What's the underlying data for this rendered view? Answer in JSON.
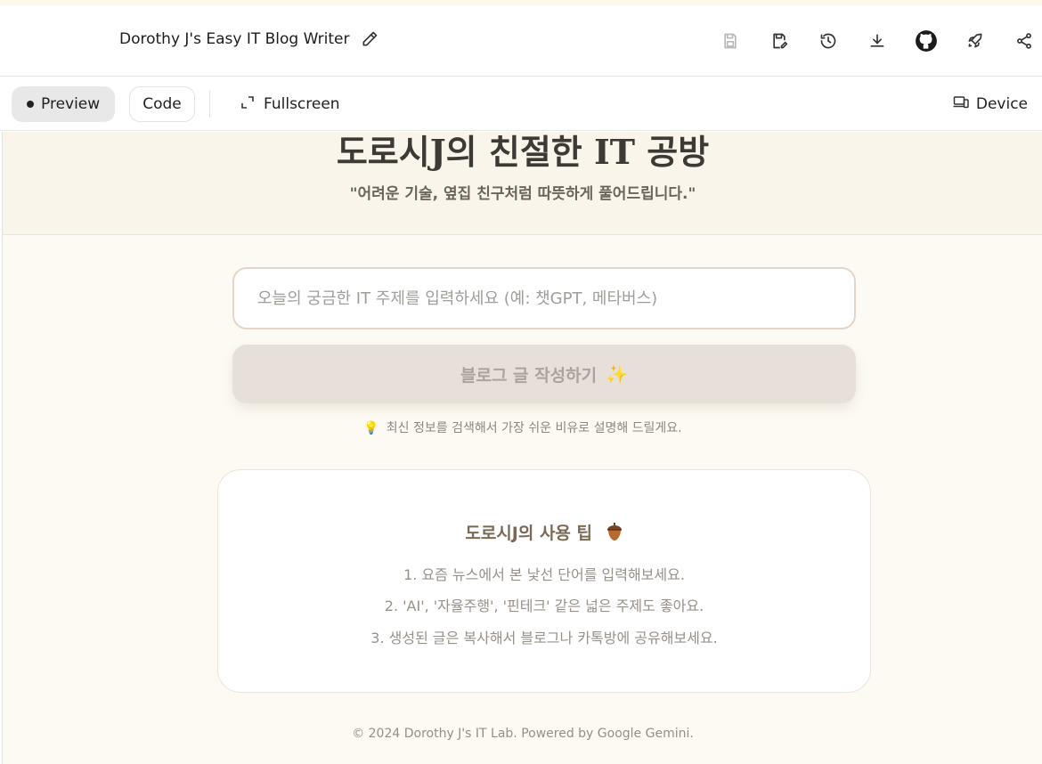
{
  "app": {
    "title": "Dorothy J's Easy IT Blog Writer"
  },
  "toolbar": {
    "preview_label": "Preview",
    "code_label": "Code",
    "fullscreen_label": "Fullscreen",
    "device_label": "Device"
  },
  "hero": {
    "title": "도로시J의 친절한 IT 공방",
    "subtitle": "\"어려운 기술, 옆집 친구처럼 따뜻하게 풀어드립니다.\""
  },
  "form": {
    "placeholder": "오늘의 궁금한 IT 주제를 입력하세요 (예: 챗GPT, 메타버스)",
    "value": "",
    "submit_label": "블로그 글 작성하기",
    "hint": "최신 정보를 검색해서 가장 쉬운 비유로 설명해 드릴게요."
  },
  "tips": {
    "title": "도로시J의 사용 팁",
    "items": [
      "1. 요즘 뉴스에서 본 낯선 단어를 입력해보세요.",
      "2. 'AI', '자율주행', '핀테크' 같은 넓은 주제도 좋아요.",
      "3. 생성된 글은 복사해서 블로그나 카톡방에 공유해보세요."
    ]
  },
  "footer": {
    "text": "© 2024 Dorothy J's IT Lab. Powered by Google Gemini."
  },
  "icons": {
    "edit": "pencil-icon",
    "save": "save-icon",
    "save_edit": "save-edit-icon",
    "history": "history-icon",
    "download": "download-icon",
    "github": "github-icon",
    "deploy": "rocket-icon",
    "share": "share-icon",
    "fullscreen": "expand-icon",
    "device": "device-icon",
    "hint": "lightbulb-icon",
    "tips": "acorn-icon",
    "submit": "sparkles-icon"
  },
  "colors": {
    "page_background": "#fdfaf3",
    "hero_background": "#faf5ea",
    "input_border": "#e3d6c6",
    "button_disabled": "#e6e0d8",
    "tips_title": "#7a6a55"
  }
}
